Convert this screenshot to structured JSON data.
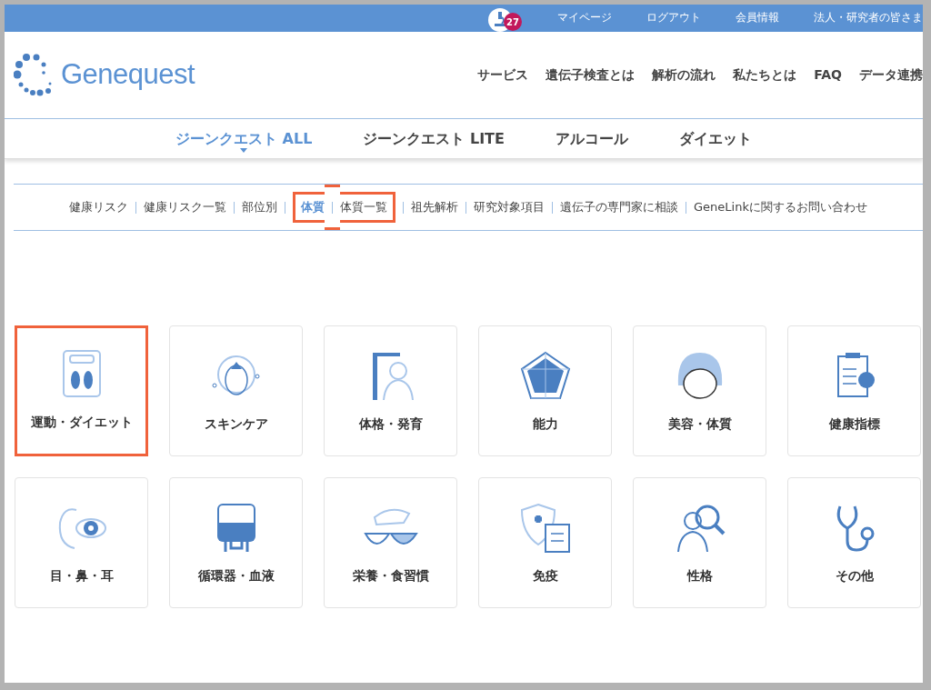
{
  "top_bar": {
    "notification_count": "27",
    "links": [
      "マイページ",
      "ログアウト",
      "会員情報",
      "法人・研究者の皆さま"
    ]
  },
  "header": {
    "logo_text": "Genequest",
    "nav": [
      "サービス",
      "遺伝子検査とは",
      "解析の流れ",
      "私たちとは",
      "FAQ",
      "データ連携"
    ]
  },
  "tabs": [
    {
      "label": "ジーンクエスト ALL",
      "selected": true
    },
    {
      "label": "ジーンクエスト LITE",
      "selected": false
    },
    {
      "label": "アルコール",
      "selected": false
    },
    {
      "label": "ダイエット",
      "selected": false
    }
  ],
  "subnav": [
    {
      "label": "健康リスク",
      "selected": false,
      "highlighted": false
    },
    {
      "label": "健康リスク一覧",
      "selected": false,
      "highlighted": false
    },
    {
      "label": "部位別",
      "selected": false,
      "highlighted": false
    },
    {
      "label": "体質",
      "selected": true,
      "highlighted": true
    },
    {
      "label": "体質一覧",
      "selected": false,
      "highlighted": true
    },
    {
      "label": "祖先解析",
      "selected": false,
      "highlighted": false
    },
    {
      "label": "研究対象項目",
      "selected": false,
      "highlighted": false
    },
    {
      "label": "遺伝子の専門家に相談",
      "selected": false,
      "highlighted": false
    },
    {
      "label": "GeneLinkに関するお問い合わせ",
      "selected": false,
      "highlighted": false
    }
  ],
  "categories": [
    {
      "label": "運動・ダイエット",
      "highlighted": true
    },
    {
      "label": "スキンケア",
      "highlighted": false
    },
    {
      "label": "体格・発育",
      "highlighted": false
    },
    {
      "label": "能力",
      "highlighted": false
    },
    {
      "label": "美容・体質",
      "highlighted": false
    },
    {
      "label": "健康指標",
      "highlighted": false
    },
    {
      "label": "目・鼻・耳",
      "highlighted": false
    },
    {
      "label": "循環器・血液",
      "highlighted": false
    },
    {
      "label": "栄養・食習慣",
      "highlighted": false
    },
    {
      "label": "免疫",
      "highlighted": false
    },
    {
      "label": "性格",
      "highlighted": false
    },
    {
      "label": "その他",
      "highlighted": false
    }
  ]
}
